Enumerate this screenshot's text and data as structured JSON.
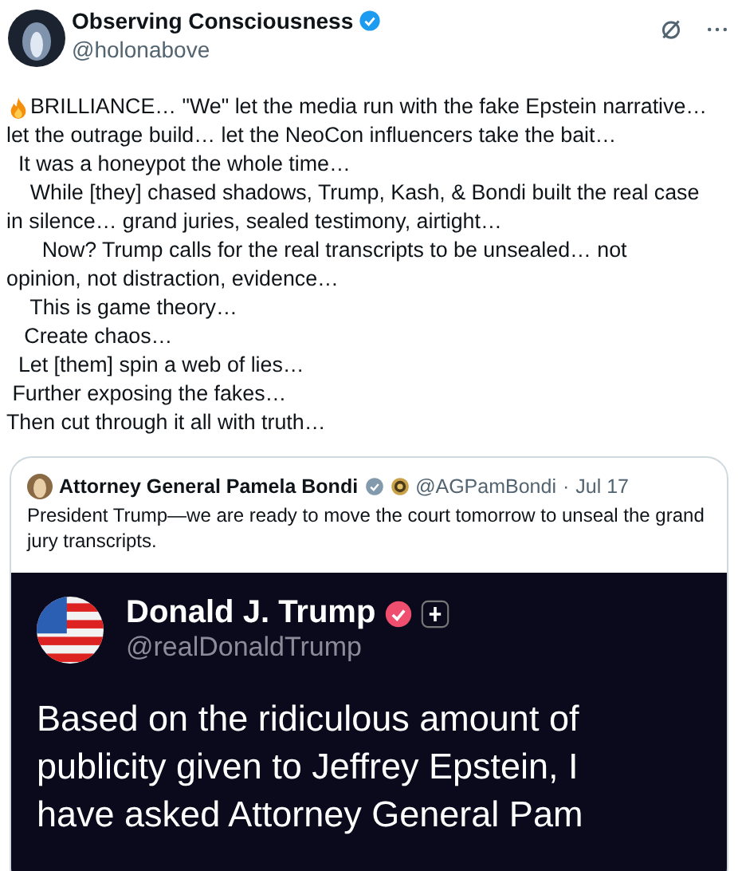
{
  "author": {
    "name": "Observing Consciousness",
    "verified": true,
    "handle": "@holonabove"
  },
  "text_lines": [
    "BRILLIANCE… \"We\" let the media run with the fake Epstein narrative…",
    "let the outrage build… let the NeoCon influencers take the bait…",
    "  It was a honeypot the whole time…",
    "    While [they] chased shadows, Trump, Kash, & Bondi built the real case",
    "in silence… grand juries, sealed testimony, airtight…",
    "      Now? Trump calls for the real transcripts to be unsealed… not",
    "opinion, not distraction, evidence…",
    "    This is game theory…",
    "   Create chaos…",
    "  Let [them] spin a web of lies…",
    " Further exposing the fakes…",
    "Then cut through it all with truth…"
  ],
  "quote": {
    "name": "Attorney General Pamela Bondi",
    "verified": true,
    "handle": "@AGPamBondi",
    "separator": "·",
    "date": "Jul 17",
    "text": "President Trump—we are ready to move the court tomorrow to unseal the grand jury transcripts.",
    "image": {
      "name": "Donald J. Trump",
      "verified": true,
      "handle": "@realDonaldTrump",
      "lines": [
        "Based on the ridiculous amount of",
        "publicity given to Jeffrey Epstein, I",
        "have asked Attorney General Pam"
      ]
    }
  }
}
